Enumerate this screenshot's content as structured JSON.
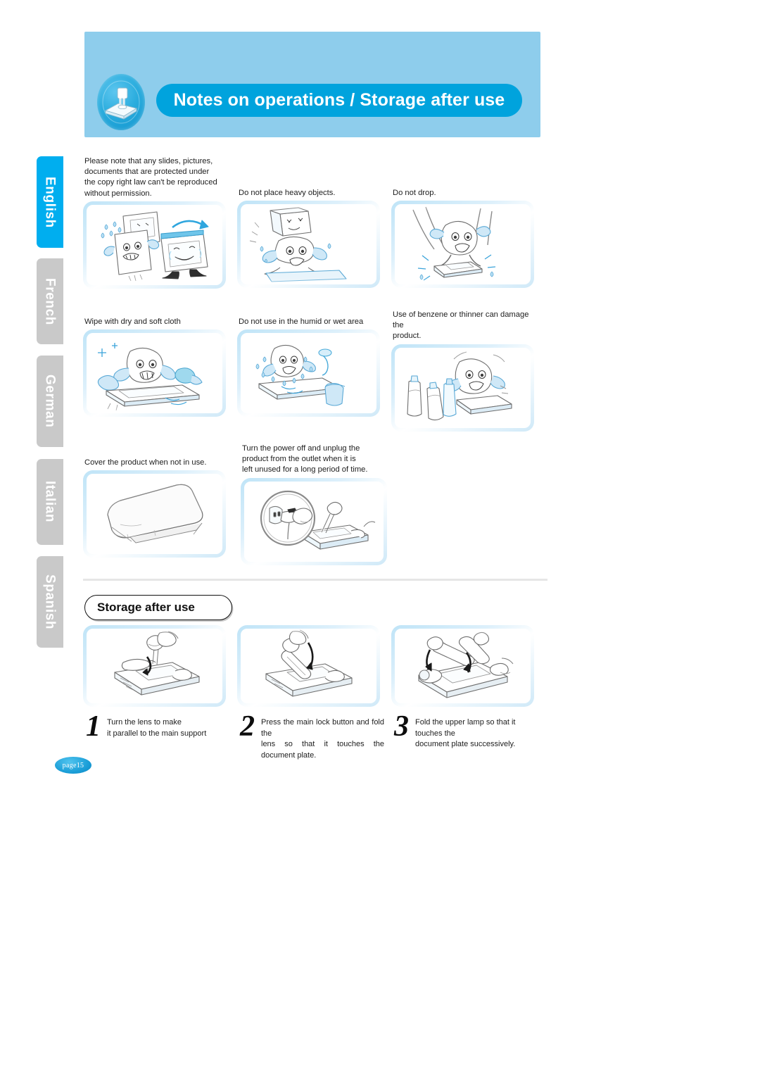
{
  "header": {
    "title": "Notes on operations / Storage after use",
    "icon": "document-camera-icon",
    "band_color": "#8ecdec",
    "pill_color": "#00a3dd"
  },
  "sidebar": {
    "active_color": "#00aeef",
    "inactive_color": "#c9c9c9",
    "items": [
      {
        "label": "English",
        "active": true
      },
      {
        "label": "French",
        "active": false
      },
      {
        "label": "German",
        "active": false
      },
      {
        "label": "Italian",
        "active": false
      },
      {
        "label": "Spanish",
        "active": false
      }
    ]
  },
  "notes": {
    "panels": [
      {
        "caption": "Please note that any slides, pictures,\ndocuments that are protected under\nthe copy right law can't be reproduced\nwithout permission.",
        "illustration": "crying-documents-and-monitor-illustration"
      },
      {
        "caption": "Do not place heavy objects.",
        "illustration": "heavy-objects-on-product-illustration"
      },
      {
        "caption": "Do not drop.",
        "illustration": "dropping-product-illustration"
      },
      {
        "caption": "Wipe with dry and soft cloth",
        "illustration": "wiping-with-cloth-illustration"
      },
      {
        "caption": "Do not use in the humid or wet area",
        "illustration": "humid-wet-area-illustration"
      },
      {
        "caption": "Use of benzene or thinner can damage the\nproduct.",
        "illustration": "benzene-thinner-bottles-illustration"
      },
      {
        "caption": "Cover the product when not in use.",
        "illustration": "covered-product-illustration"
      },
      {
        "caption": "Turn the power off and unplug the\nproduct from the outlet when it is\nleft unused for a long period of time.",
        "illustration": "unplug-from-outlet-illustration"
      }
    ]
  },
  "storage": {
    "section_title": "Storage after use",
    "steps": [
      {
        "number": "1",
        "text": "Turn the lens to make\nit parallel to the main support",
        "illustration": "turn-lens-illustration"
      },
      {
        "number": "2",
        "text": "Press the main lock button and fold the\nlens so that it touches the document plate.",
        "illustration": "fold-lens-illustration"
      },
      {
        "number": "3",
        "text": "Fold the upper lamp so that it touches the\ndocument plate successively.",
        "illustration": "fold-lamps-illustration"
      }
    ]
  },
  "footer": {
    "page_label": "page15"
  }
}
